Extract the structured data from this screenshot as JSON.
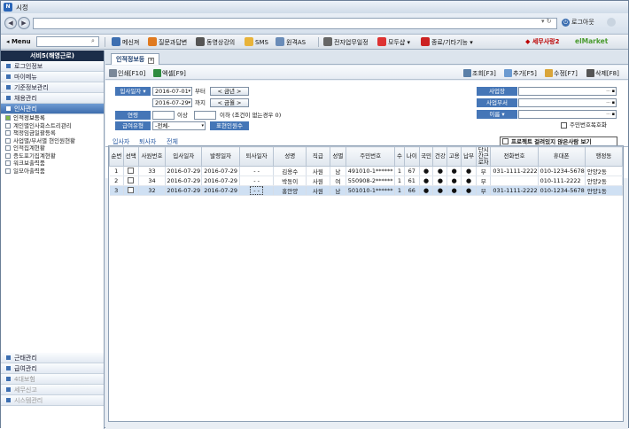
{
  "window": {
    "title": "시정"
  },
  "logout_label": "로그아웃",
  "menu": {
    "label": "◂ Menu"
  },
  "toolbar": [
    {
      "label": "메신져",
      "color": "#3d6fb1"
    },
    {
      "label": "질문과답변",
      "color": "#e07a1f"
    },
    {
      "label": "동영상강의",
      "color": "#555"
    },
    {
      "label": "SMS",
      "color": "#e8b33a"
    },
    {
      "label": "원격AS",
      "color": "#6a8cb8"
    },
    {
      "label": "전자업무일정",
      "color": "#666"
    },
    {
      "label": "모두샵 ▾",
      "color": "#d33"
    },
    {
      "label": "종료/기타기능 ▾",
      "color": "#c22"
    }
  ],
  "brand": {
    "left": "◆ 세무사랑2",
    "right": "elMarket"
  },
  "sidebar": {
    "header": "서비5(해영근로)",
    "sections_top": [
      "로그인정보",
      "마이메뉴",
      "기준정보관리",
      "채용관리",
      "인사관리"
    ],
    "items": [
      "인적정보등록",
      "계인별인사회스트리관리",
      "책정임금일괄등록",
      "사업별/부서별 현인원현황",
      "인적집계현황",
      "증도포기집계현황",
      "워크보출력품",
      "일모아출력품"
    ],
    "sections_bottom": [
      "근태관리",
      "급여관리",
      "4대보험",
      "세무신고",
      "시스템관리"
    ]
  },
  "tab": {
    "label": "인적정보등"
  },
  "actions": {
    "print": "인쇄[F10]",
    "excel": "엑셀[F9]",
    "search": "조회[F3]",
    "add": "추가[F5]",
    "edit": "수정[F7]",
    "delete": "삭제[F8]"
  },
  "filters": {
    "date_type": "입사일자",
    "date_from": "2016-07-01",
    "from_suffix": "부터",
    "date_to": "2016-07-29",
    "to_suffix": "까지",
    "prev_week": "< 금년 >",
    "prev_month": "< 금월 >",
    "age_label": "연령",
    "age_min_suffix": "이상",
    "age_max_suffix": "이하 (조건이 없는경우 0)",
    "pay_type_label": "급여유형",
    "pay_type_value": "-전체-",
    "disabled_label": "표현인원수",
    "workplace_label": "사업장",
    "dept_label": "사업부서",
    "name_label": "이름",
    "hide_ssn": "주민번호복호화"
  },
  "subtabs": [
    "입사자",
    "퇴사자",
    "전체"
  ],
  "project_check": "프로젝트 걸려있지 않은사람 보기",
  "table": {
    "columns": [
      "순번",
      "선택",
      "사원번호",
      "입사일자",
      "발령일자",
      "퇴사일자",
      "성명",
      "직급",
      "성별",
      "주민번호",
      "수",
      "나이",
      "국민",
      "건강",
      "고용",
      "납부",
      "단시간근로자",
      "전화번호",
      "휴대폰",
      "행정동"
    ],
    "rows": [
      [
        "1",
        "",
        "33",
        "2016-07-29",
        "2016-07-29",
        "- -",
        "김용수",
        "사원",
        "남",
        "491010-1******",
        "1",
        "67",
        "●",
        "●",
        "●",
        "●",
        "부",
        "031-1111-2222",
        "010-1234-5678",
        "안양2동"
      ],
      [
        "2",
        "",
        "34",
        "2016-07-29",
        "2016-07-29",
        "- -",
        "박동이",
        "사원",
        "여",
        "550908-2******",
        "1",
        "61",
        "●",
        "●",
        "●",
        "●",
        "부",
        "",
        "010-111-2222",
        "안양2동"
      ],
      [
        "3",
        "",
        "32",
        "2016-07-29",
        "2016-07-29",
        "- -",
        "홍안양",
        "사원",
        "남",
        "501010-1******",
        "1",
        "66",
        "●",
        "●",
        "●",
        "●",
        "부",
        "031-1111-2222",
        "010-1234-5678",
        "안양1동"
      ]
    ]
  }
}
